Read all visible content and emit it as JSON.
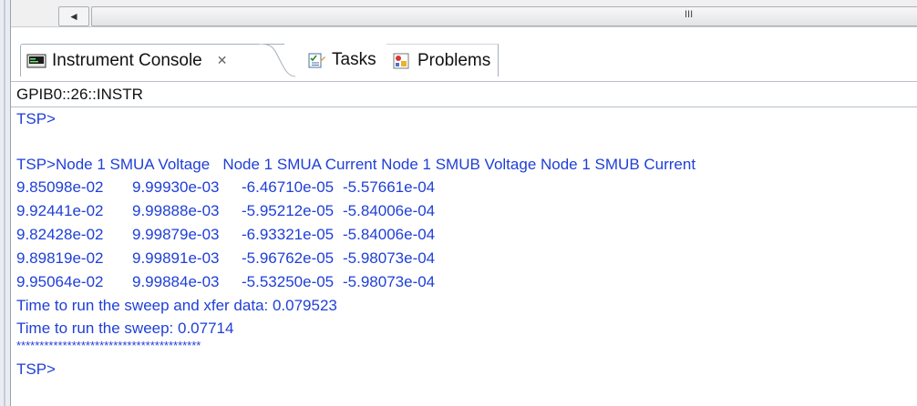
{
  "scrollbar": {
    "left_arrow": "◄",
    "grip": "III"
  },
  "tabs": [
    {
      "label": "Instrument Console",
      "close": "✕",
      "icon": "console-icon"
    },
    {
      "label": "Tasks",
      "icon": "tasks-icon"
    },
    {
      "label": "Problems",
      "icon": "problems-icon"
    }
  ],
  "instrument_address": "GPIB0::26::INSTR",
  "console": {
    "prompt1": "TSP>",
    "header": "TSP>Node 1 SMUA Voltage   Node 1 SMUA Current Node 1 SMUB Voltage Node 1 SMUB Current",
    "rows": [
      [
        "9.85098e-02",
        "9.99930e-03",
        "-6.46710e-05",
        "-5.57661e-04"
      ],
      [
        "9.92441e-02",
        "9.99888e-03",
        "-5.95212e-05",
        "-5.84006e-04"
      ],
      [
        "9.82428e-02",
        "9.99879e-03",
        "-6.93321e-05",
        "-5.84006e-04"
      ],
      [
        "9.89819e-02",
        "9.99891e-03",
        "-5.96762e-05",
        "-5.98073e-04"
      ],
      [
        "9.95064e-02",
        "9.99884e-03",
        "-5.53250e-05",
        "-5.98073e-04"
      ]
    ],
    "time_xfer": "Time to run the sweep and xfer data: 0.079523",
    "time_sweep": "Time to run the sweep: 0.07714",
    "separator": "****************************************",
    "prompt2": "TSP>"
  },
  "colors": {
    "console_text": "#1f3fd6",
    "tab_border": "#a6b0bb"
  }
}
